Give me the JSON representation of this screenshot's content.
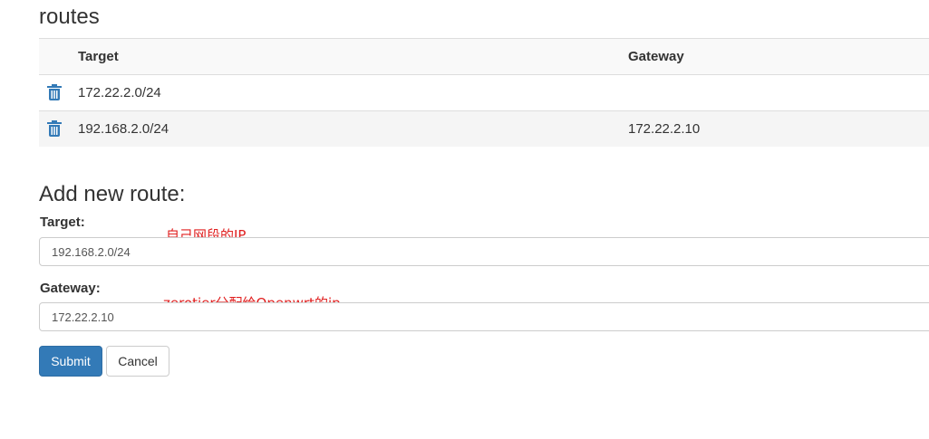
{
  "page": {
    "title": "routes"
  },
  "routes_table": {
    "columns": [
      "Target",
      "Gateway"
    ],
    "rows": [
      {
        "target": "172.22.2.0/24",
        "gateway": ""
      },
      {
        "target": "192.168.2.0/24",
        "gateway": "172.22.2.10"
      }
    ],
    "delete_icon": "trash-icon"
  },
  "add_route": {
    "title": "Add new route:",
    "target_label": "Target:",
    "target_value": "192.168.2.0/24",
    "gateway_label": "Gateway:",
    "gateway_value": "172.22.2.10",
    "submit_label": "Submit",
    "cancel_label": "Cancel"
  },
  "annotations": {
    "target_note": "自己网段的IP",
    "gateway_note": "zerotier分配给Openwrt的ip"
  },
  "colors": {
    "primary": "#337ab7",
    "annotation": "#e02020",
    "icon": "#337ab7"
  }
}
